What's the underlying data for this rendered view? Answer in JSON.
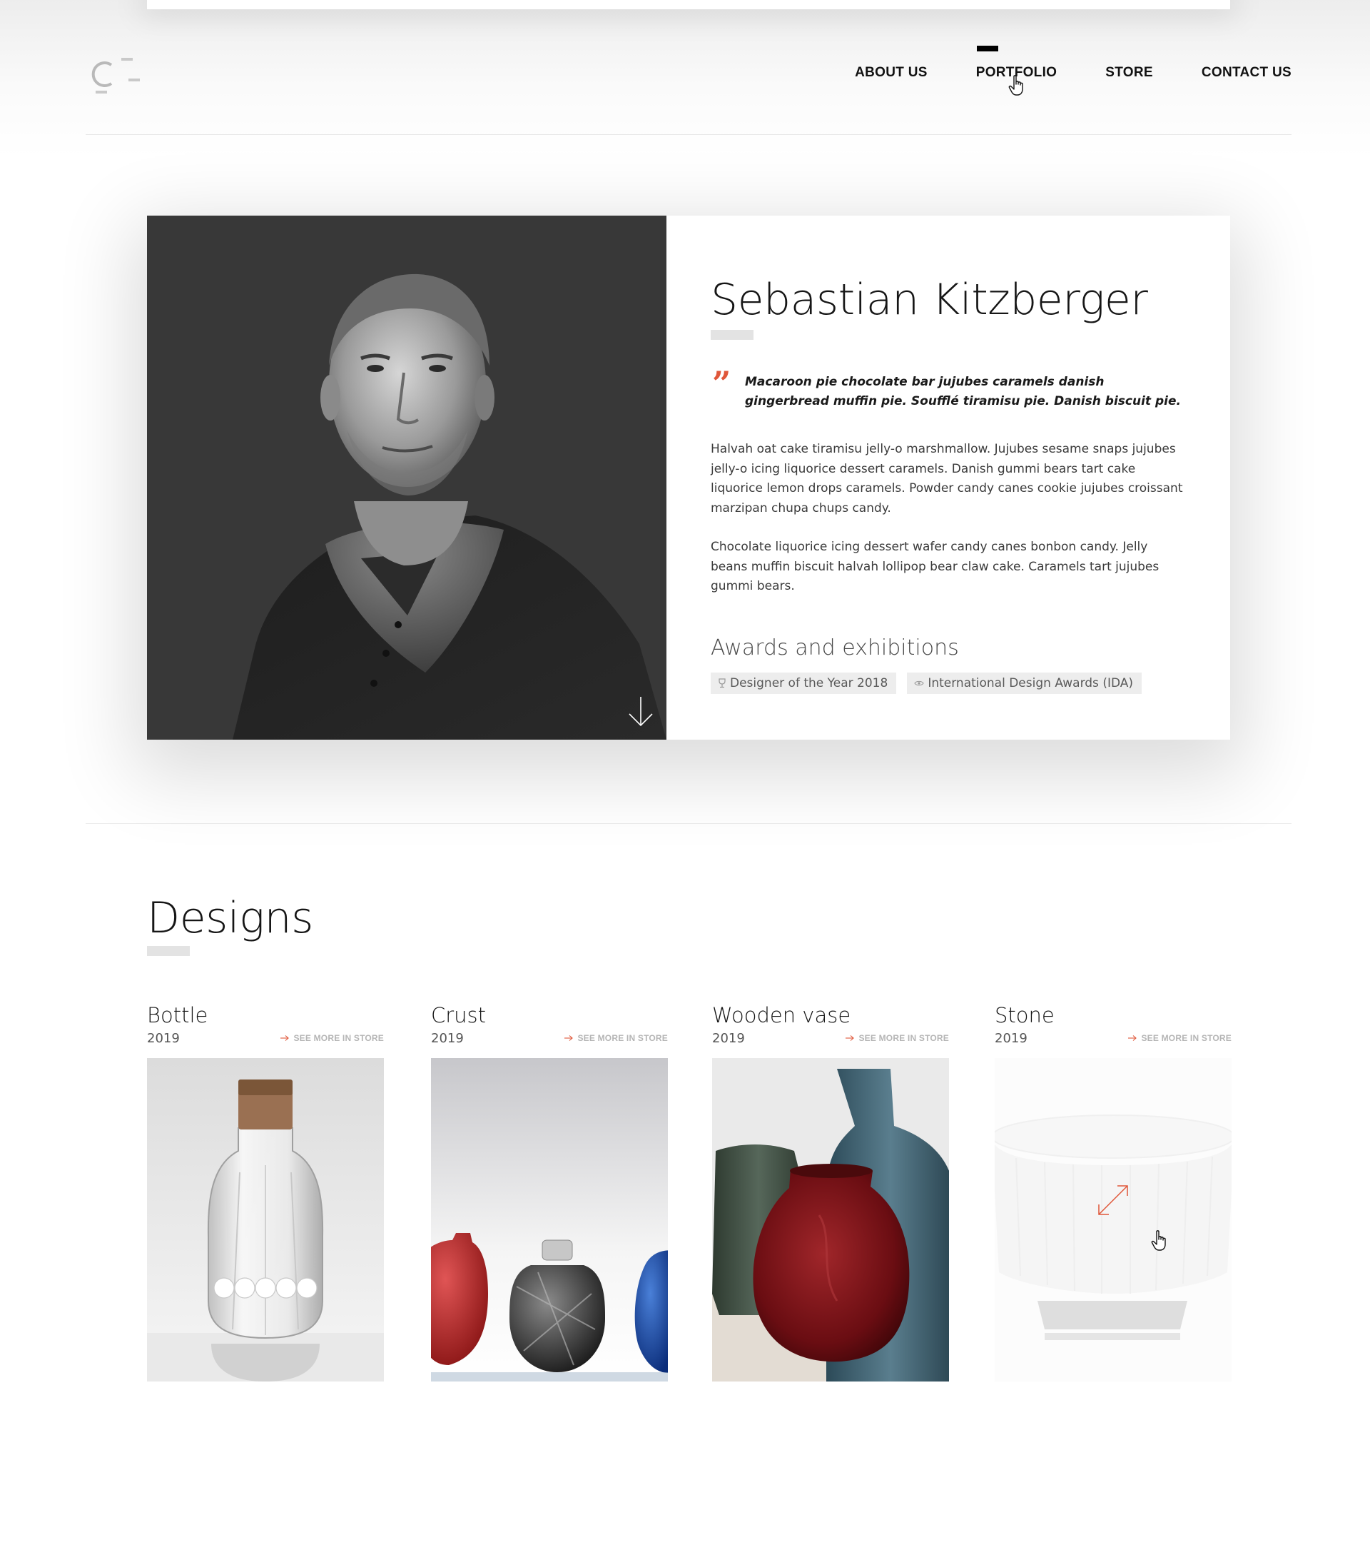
{
  "header": {
    "logo_alt": "C-",
    "nav": [
      {
        "label": "ABOUT US"
      },
      {
        "label": "PORTFOLIO"
      },
      {
        "label": "STORE"
      },
      {
        "label": "CONTACT US"
      }
    ],
    "active_nav": "PORTFOLIO"
  },
  "profile": {
    "name": "Sebastian Kitzberger",
    "quote": "Macaroon pie chocolate bar jujubes caramels danish gingerbread muffin pie. Soufflé tiramisu pie. Danish biscuit pie.",
    "paragraphs": [
      "Halvah oat cake tiramisu jelly-o marshmallow. Jujubes sesame snaps jujubes jelly-o icing liquorice dessert caramels. Danish gummi bears tart cake liquorice lemon drops caramels. Powder candy canes cookie jujubes croissant marzipan chupa chups candy.",
      "Chocolate liquorice icing dessert wafer candy canes bonbon candy. Jelly beans muffin biscuit halvah lollipop bear claw cake. Caramels tart jujubes gummi bears."
    ],
    "awards_title": "Awards and exhibitions",
    "awards": [
      {
        "icon": "trophy-icon",
        "label": "Designer of the Year 2018"
      },
      {
        "icon": "eye-icon",
        "label": "International Design Awards (IDA)"
      }
    ]
  },
  "designs": {
    "title": "Designs",
    "items": [
      {
        "name": "Bottle",
        "year": "2019",
        "link": "SEE MORE IN STORE"
      },
      {
        "name": "Crust",
        "year": "2019",
        "link": "SEE MORE IN STORE"
      },
      {
        "name": "Wooden vase",
        "year": "2019",
        "link": "SEE MORE IN STORE"
      },
      {
        "name": "Stone",
        "year": "2019",
        "link": "SEE MORE IN STORE"
      }
    ]
  },
  "colors": {
    "accent": "#e0573a",
    "text_dark": "#161616",
    "portrait_bg": "#383838",
    "tag_bg": "#ededed"
  }
}
